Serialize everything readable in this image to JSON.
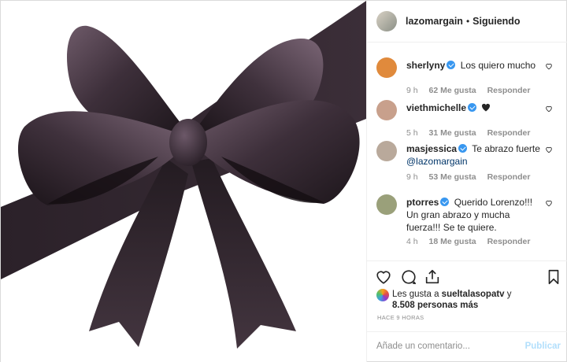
{
  "post": {
    "author": "lazomargain",
    "separator": "•",
    "follow_state": "Siguiendo",
    "image_alt": "black-ribbon-bow"
  },
  "comments": [
    {
      "user": "sherlyny",
      "verified": true,
      "text": "Los quiero mucho",
      "mention": "",
      "time": "9 h",
      "likes": "62 Me gusta",
      "reply": "Responder",
      "avatar_color": "#e08a3c"
    },
    {
      "user": "viethmichelle",
      "verified": true,
      "text": "",
      "emoji": "black-heart",
      "mention": "",
      "time": "5 h",
      "likes": "31 Me gusta",
      "reply": "Responder",
      "avatar_color": "#c8a08c"
    },
    {
      "user": "masjessica",
      "verified": true,
      "text": "Te abrazo fuerte",
      "mention": "@lazomargain",
      "time": "9 h",
      "likes": "53 Me gusta",
      "reply": "Responder",
      "avatar_color": "#b9a99b"
    },
    {
      "user": "ptorres",
      "verified": true,
      "text": "Querido Lorenzo!!! Un gran abrazo y mucha fuerza!!! Se te quiere.",
      "mention": "",
      "time": "4 h",
      "likes": "18 Me gusta",
      "reply": "Responder",
      "avatar_color": "#9aa07a"
    }
  ],
  "likes": {
    "prefix": "Les gusta a",
    "user": "sueltalasopatv",
    "conj": "y",
    "count": "8.508 personas más"
  },
  "timestamp": "HACE 9 HORAS",
  "composer": {
    "placeholder": "Añade un comentario...",
    "post_label": "Publicar"
  },
  "colors": {
    "ribbon_dark": "#2a2128",
    "ribbon_mid": "#4a3a46",
    "ribbon_light": "#8a7484",
    "verified": "#3897f0",
    "muted": "#8e8e8e",
    "publish_disabled": "#b2dffc"
  }
}
